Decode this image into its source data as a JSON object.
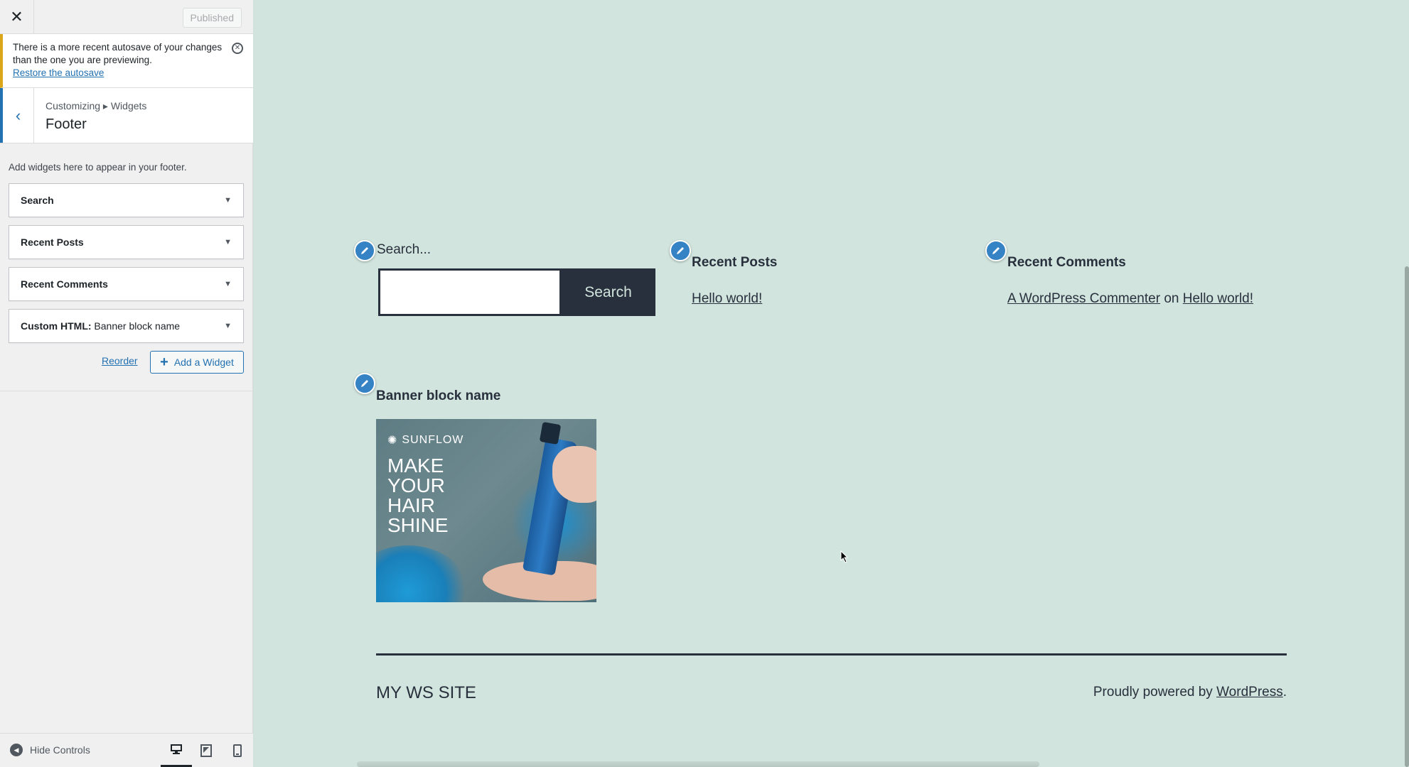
{
  "topbar": {
    "publish_label": "Published"
  },
  "notice": {
    "text": "There is a more recent autosave of your changes than the one you are previewing.",
    "link": "Restore the autosave"
  },
  "section": {
    "breadcrumb": "Customizing ▸ Widgets",
    "title": "Footer"
  },
  "description": "Add widgets here to appear in your footer.",
  "widgets": [
    {
      "label": "Search",
      "sub": ""
    },
    {
      "label": "Recent Posts",
      "sub": ""
    },
    {
      "label": "Recent Comments",
      "sub": ""
    },
    {
      "label": "Custom HTML:",
      "sub": " Banner block name"
    }
  ],
  "actions": {
    "reorder": "Reorder",
    "add_widget": "Add a Widget"
  },
  "footer_controls": {
    "hide_controls": "Hide Controls"
  },
  "preview": {
    "search_label": "Search...",
    "search_button": "Search",
    "recent_posts_title": "Recent Posts",
    "recent_post_1": "Hello world!",
    "recent_comments_title": "Recent Comments",
    "commenter": "A WordPress Commenter",
    "on_word": "on",
    "comment_post": "Hello world!",
    "banner_title": "Banner block name",
    "banner_brand": "SUNFLOW",
    "banner_headline": "MAKE YOUR HAIR SHINE",
    "site_name": "MY WS SITE",
    "powered_prefix": "Proudly powered by ",
    "powered_link": "WordPress",
    "powered_suffix": "."
  },
  "colors": {
    "accent": "#2271b1",
    "notice": "#dba617",
    "preview_bg": "#d1e4dd",
    "text_dark": "#28303d"
  }
}
